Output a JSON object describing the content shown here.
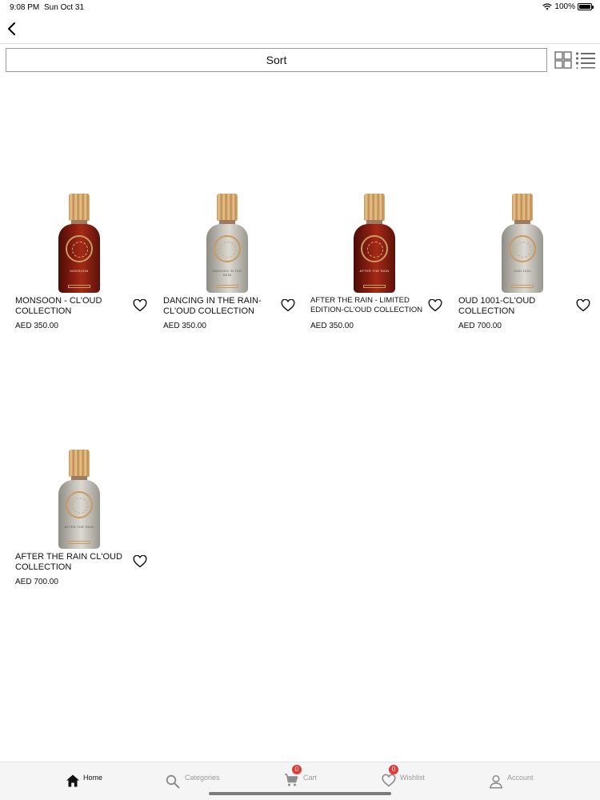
{
  "status_bar": {
    "time": "9:08 PM",
    "date": "Sun Oct 31",
    "battery": "100%"
  },
  "toolbar": {
    "sort_label": "Sort"
  },
  "products": [
    {
      "name": "MONSOON - CL'OUD COLLECTION",
      "price": "AED 350.00",
      "bottle_color": "red",
      "bottle_text": "MONSOON"
    },
    {
      "name": "DANCING IN THE RAIN- CL'OUD COLLECTION",
      "price": "AED 350.00",
      "bottle_color": "silver",
      "bottle_text": "DANCING IN THE RAIN"
    },
    {
      "name": "AFTER THE RAIN - LIMITED EDITION-CL'OUD COLLECTION",
      "price": "AED 350.00",
      "bottle_color": "red",
      "bottle_text": "AFTER THE RAIN"
    },
    {
      "name": "OUD 1001-CL'OUD COLLECTION",
      "price": "AED 700.00",
      "bottle_color": "silver",
      "bottle_text": "OUD 1001"
    },
    {
      "name": "AFTER THE RAIN CL'OUD COLLECTION",
      "price": "AED 700.00",
      "bottle_color": "silver",
      "bottle_text": "AFTER THE RAIN"
    }
  ],
  "bottom_nav": {
    "home": "Home",
    "categories": "Categories",
    "cart": "Cart",
    "cart_count": "0",
    "wishlist": "Wishlist",
    "wishlist_count": "0",
    "account": "Account"
  }
}
